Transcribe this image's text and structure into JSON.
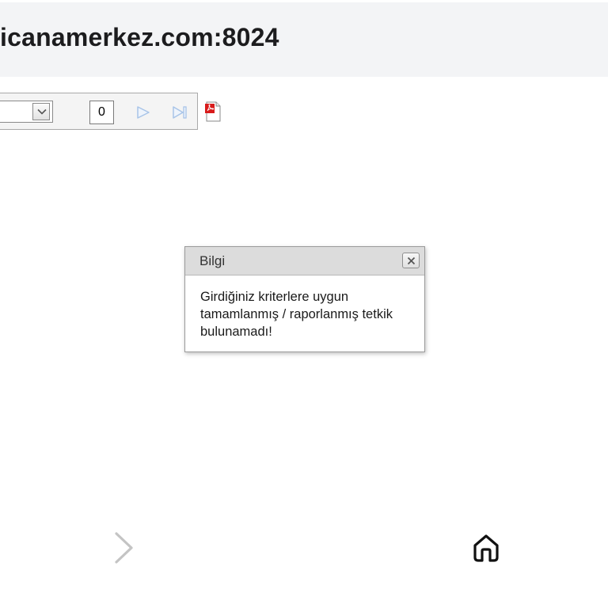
{
  "browser": {
    "url": "icanamerkez.com:8024"
  },
  "toolbar": {
    "page_number": "0",
    "icons": {
      "dropdown": "chevron-down-icon",
      "next": "play-next-icon",
      "last": "skip-last-icon",
      "export": "pdf-file-icon"
    }
  },
  "dialog": {
    "title": "Bilgi",
    "message": "Girdiğiniz kriterlere uygun tamamlanmış / raporlanmış tetkik bulunamadı!",
    "close_icon": "close-icon"
  },
  "bottom_nav": {
    "forward_icon": "chevron-right-icon",
    "home_icon": "home-icon"
  },
  "colors": {
    "url_bar_bg": "#f3f4f6",
    "dialog_header_bg": "#dcdcdc",
    "toolbar_bg": "#f4f4f4",
    "disabled_nav_icon": "#a8c4e8",
    "pdf_red": "#d81b1b"
  }
}
